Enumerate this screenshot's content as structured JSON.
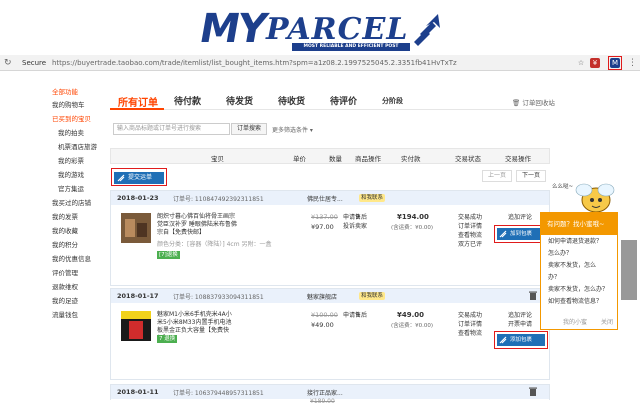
{
  "banner": {
    "logo_my": "MY",
    "logo_parcel": "PARCEL",
    "logo_tagline": "MOST RELIABLE AND EFFICIENT POST"
  },
  "browser": {
    "secure_label": "Secure",
    "url": "https://buyertrade.taobao.com/trade/itemlist/list_bought_items.htm?spm=a1z08.2.1997525045.2.3351fb41HvTxTz"
  },
  "sidebar": {
    "items": [
      "全部功能",
      "我的购物车",
      "已买到的宝贝",
      "我的拍卖",
      "机票酒店旅游",
      "我的彩票",
      "我的游戏",
      "官方集运",
      "我买过的店铺",
      "我的发票",
      "我的收藏",
      "我的积分",
      "我的优惠信息",
      "评价管理",
      "退款维权",
      "我的足迹",
      "流量钱包"
    ]
  },
  "tabs": {
    "items": [
      "所有订单",
      "待付款",
      "待发货",
      "待收货",
      "待评价",
      "分阶段"
    ],
    "recycle_label": "订单回收站"
  },
  "search": {
    "placeholder": "输入商品标题或订单号进行搜索",
    "button_label": "订单搜索",
    "more_filter_label": "更多筛选条件"
  },
  "table_header": {
    "columns": [
      "宝贝",
      "单价",
      "数量",
      "商品操作",
      "实付款",
      "交易状态",
      "交易操作"
    ]
  },
  "toolbar": {
    "submit_label": "提交运单",
    "prev_label": "上一页",
    "next_label": "下一页"
  },
  "orders": [
    {
      "date": "2018-01-23",
      "order_no": "订单号: 110847492392311851",
      "shop": "佛民仕居专...",
      "chat_label": "和我联系",
      "title": "朗炽寸暮心佛百仙将骨王画宗觉臣汉补罗 睡眼佛陆米布鲁佛宗自【免费快邮】",
      "attr": "颜色分类：[容器（降陆）] 4cm   另附：一盒",
      "badge": "[7]退换",
      "price_old": "¥137.00",
      "price": "¥97.00",
      "qty": "2",
      "ops": [
        "申请售后",
        "投诉卖家"
      ],
      "total": "¥194.00",
      "ship": "(含运费：¥0.00)",
      "status": [
        "交易成功",
        "订单详情",
        "查看物流",
        "双方已评"
      ],
      "actions": [
        "追加评论",
        "申请开票"
      ],
      "myparcel_label": "加到包裹"
    },
    {
      "date": "2018-01-17",
      "order_no": "订单号: 108837933094311851",
      "shop": "魅家旗舰店",
      "chat_label": "和我联系",
      "title": "魅家M1小米6手机壳米4A小米5小米8M33内置手机电池板黑金正负大容量【免费快邮】",
      "attr": "",
      "badge": "7 退换",
      "price_old": "¥100.00",
      "price": "¥49.00",
      "qty": "1",
      "ops": [
        "申请售后"
      ],
      "total": "¥49.00",
      "ship": "(含运费：¥0.00)",
      "status": [
        "交易成功",
        "订单详情",
        "查看物流"
      ],
      "actions": [
        "追加评论",
        "开票申请"
      ],
      "myparcel_label": "添加包裹"
    },
    {
      "date": "2018-01-11",
      "order_no": "订单号: 106379448957311851",
      "shop": "接行正品家...",
      "chat_label": "",
      "price_old": "¥189.00",
      "total": "¥189.00"
    }
  ],
  "helper": {
    "bee_greeting": "么么哒~",
    "header": "有问题？找小蜜哦~",
    "questions": [
      "如何申请退货退款？",
      "怎么办？",
      "卖家不发货，怎么",
      "办？",
      "卖家不发货，怎么办？",
      "如何查看物流信息？"
    ],
    "footer_label": "我的小蜜",
    "close_label": "关闭"
  },
  "colors": {
    "brand_blue": "#1d3f8c",
    "taobao_orange": "#ff4400",
    "highlight_red": "#e01b1b",
    "myparcel_button": "#1f6fb6",
    "helper_orange": "#f39800"
  }
}
